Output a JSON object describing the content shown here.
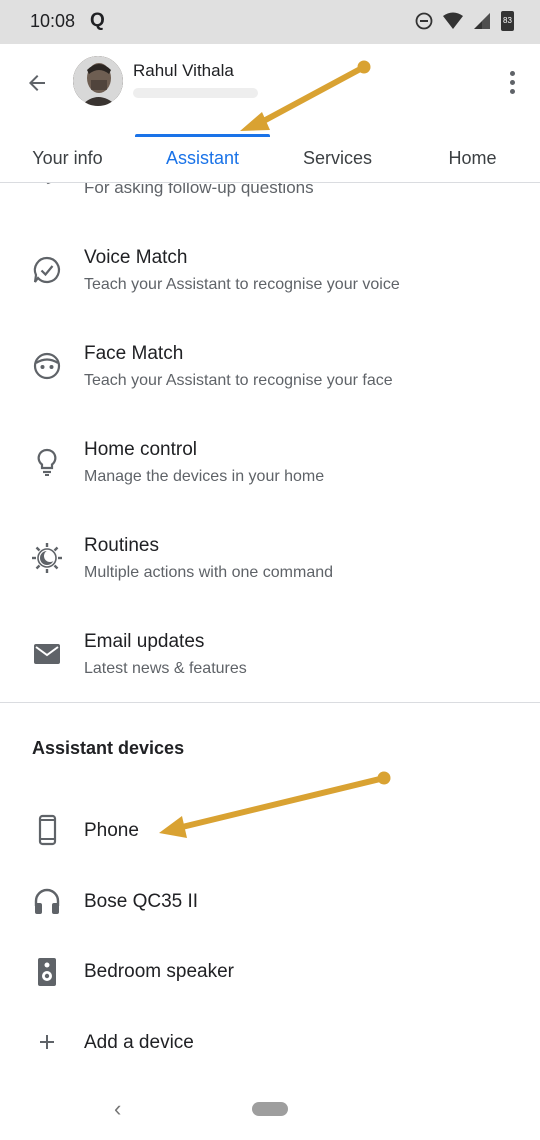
{
  "status_bar": {
    "time": "10:08",
    "notification_letter": "Q",
    "battery_level": "83"
  },
  "profile": {
    "name": "Rahul Vithala"
  },
  "tabs": [
    {
      "label": "Your info",
      "active": false
    },
    {
      "label": "Assistant",
      "active": true
    },
    {
      "label": "Services",
      "active": false
    },
    {
      "label": "Home",
      "active": false
    }
  ],
  "settings": {
    "partial": "For asking follow-up questions",
    "items": [
      {
        "icon": "voice-match-icon",
        "title": "Voice Match",
        "subtitle": "Teach your Assistant to recognise your voice"
      },
      {
        "icon": "face-match-icon",
        "title": "Face Match",
        "subtitle": "Teach your Assistant to recognise your face"
      },
      {
        "icon": "lightbulb-icon",
        "title": "Home control",
        "subtitle": "Manage the devices in your home"
      },
      {
        "icon": "routines-icon",
        "title": "Routines",
        "subtitle": "Multiple actions with one command"
      },
      {
        "icon": "email-icon",
        "title": "Email updates",
        "subtitle": "Latest news & features"
      }
    ]
  },
  "devices": {
    "section_title": "Assistant devices",
    "items": [
      {
        "icon": "phone-icon",
        "label": "Phone"
      },
      {
        "icon": "headphones-icon",
        "label": "Bose QC35 II"
      },
      {
        "icon": "speaker-icon",
        "label": "Bedroom speaker"
      },
      {
        "icon": "plus-icon",
        "label": "Add a device"
      }
    ]
  },
  "colors": {
    "accent": "#1a73e8",
    "annotation_arrow": "#d9a232",
    "icon": "#5f6368"
  }
}
